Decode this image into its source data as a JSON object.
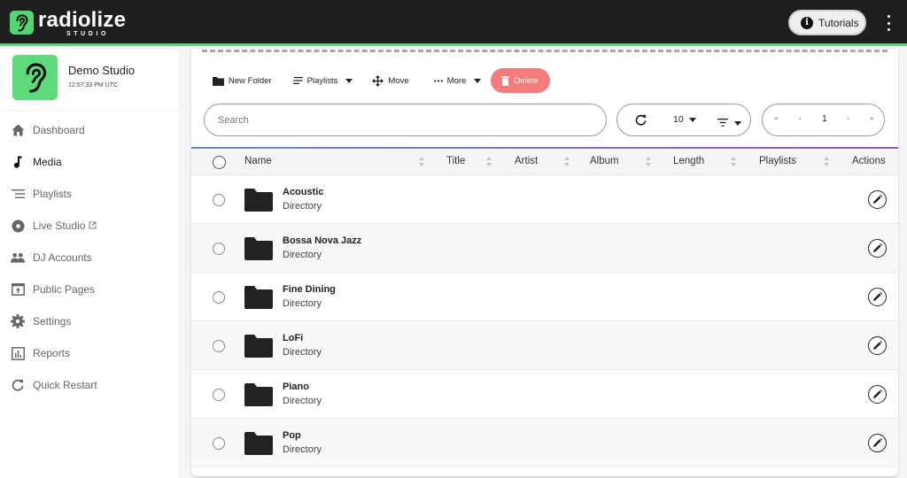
{
  "app": {
    "logo_word": "radiolize",
    "logo_sub": "STUDIO",
    "tutorials_label": "Tutorials",
    "icons": {
      "logo": "ear-icon",
      "tutorials": "info-icon",
      "menu": "kebab-menu-icon"
    }
  },
  "studio": {
    "name": "Demo Studio",
    "time": "12:57:33 PM UTC"
  },
  "sidebar": {
    "items": [
      {
        "label": "Dashboard",
        "icon": "home-icon",
        "active": false
      },
      {
        "label": "Media",
        "icon": "music-note-icon",
        "active": true
      },
      {
        "label": "Playlists",
        "icon": "playlist-icon",
        "active": false
      },
      {
        "label": "Live Studio",
        "icon": "disc-icon",
        "active": false,
        "external": true
      },
      {
        "label": "DJ Accounts",
        "icon": "people-icon",
        "active": false
      },
      {
        "label": "Public Pages",
        "icon": "publish-icon",
        "active": false
      },
      {
        "label": "Settings",
        "icon": "gear-icon",
        "active": false
      },
      {
        "label": "Reports",
        "icon": "bar-chart-icon",
        "active": false
      },
      {
        "label": "Quick Restart",
        "icon": "refresh-icon",
        "active": false
      }
    ]
  },
  "toolbar": {
    "new_folder": "New Folder",
    "playlists": "Playlists",
    "move": "Move",
    "more": "More",
    "delete": "Delete"
  },
  "search": {
    "placeholder": "Search",
    "value": ""
  },
  "controls": {
    "per_page": "10"
  },
  "pager": {
    "first": "«",
    "prev": "‹",
    "current": "1",
    "next": "›",
    "last": "»"
  },
  "table": {
    "columns": [
      "Name",
      "Title",
      "Artist",
      "Album",
      "Length",
      "Playlists",
      "Actions"
    ],
    "rows": [
      {
        "name": "Acoustic",
        "type": "Directory"
      },
      {
        "name": "Bossa Nova Jazz",
        "type": "Directory"
      },
      {
        "name": "Fine Dining",
        "type": "Directory"
      },
      {
        "name": "LoFi",
        "type": "Directory"
      },
      {
        "name": "Piano",
        "type": "Directory"
      },
      {
        "name": "Pop",
        "type": "Directory"
      }
    ]
  },
  "colors": {
    "brand_green": "#52d572",
    "topbar": "#1f1f1f",
    "delete": "#f27b7b"
  }
}
